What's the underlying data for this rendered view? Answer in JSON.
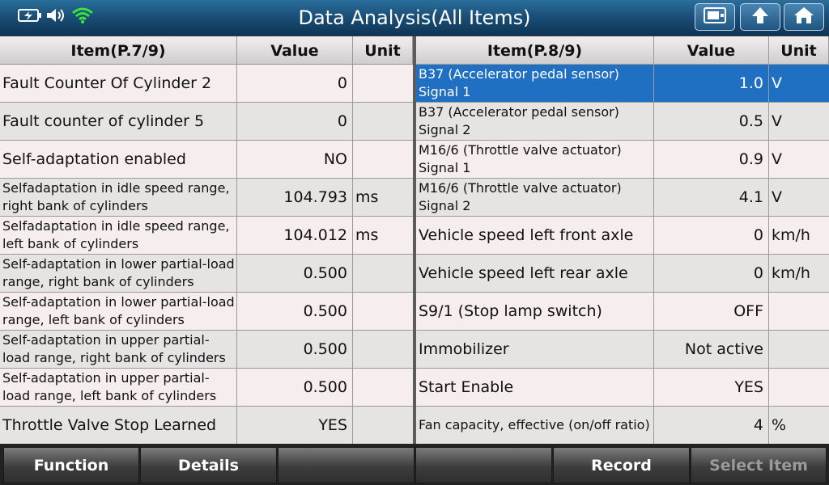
{
  "title": "Data Analysis(All Items)",
  "status_icons": [
    "battery-icon",
    "speaker-icon",
    "wifi-icon"
  ],
  "toolbar_icons": [
    "screenshot-icon",
    "back-icon",
    "home-icon"
  ],
  "colors": {
    "titlebar": "#1b4f78",
    "selected": "#1f6fc3",
    "row_light": "#f6eeee",
    "row_dark": "#e6e3e3",
    "wifi": "#3ce23c"
  },
  "left": {
    "headers": {
      "item": "Item(P.7/9)",
      "value": "Value",
      "unit": "Unit"
    },
    "rows": [
      {
        "item": "Fault Counter Of Cylinder 2",
        "value": "0",
        "unit": ""
      },
      {
        "item": "Fault counter of cylinder 5",
        "value": "0",
        "unit": ""
      },
      {
        "item": "Self-adaptation enabled",
        "value": "NO",
        "unit": ""
      },
      {
        "item": "Selfadaptation in idle speed range, right bank of cylinders",
        "value": "104.793",
        "unit": "ms"
      },
      {
        "item": "Selfadaptation in idle speed range, left bank of cylinders",
        "value": "104.012",
        "unit": "ms"
      },
      {
        "item": "Self-adaptation in lower partial-load range, right bank of cylinders",
        "value": "0.500",
        "unit": ""
      },
      {
        "item": "Self-adaptation in lower partial-load range, left bank of cylinders",
        "value": "0.500",
        "unit": ""
      },
      {
        "item": "Self-adaptation in upper partial-load range, right bank of cylinders",
        "value": "0.500",
        "unit": ""
      },
      {
        "item": "Self-adaptation in upper partial-load range, left bank of cylinders",
        "value": "0.500",
        "unit": ""
      },
      {
        "item": "Throttle Valve Stop Learned",
        "value": "YES",
        "unit": ""
      }
    ]
  },
  "right": {
    "headers": {
      "item": "Item(P.8/9)",
      "value": "Value",
      "unit": "Unit"
    },
    "rows": [
      {
        "item": "B37 (Accelerator pedal sensor) Signal 1",
        "value": "1.0",
        "unit": "V"
      },
      {
        "item": "B37 (Accelerator pedal sensor) Signal 2",
        "value": "0.5",
        "unit": "V"
      },
      {
        "item": "M16/6 (Throttle valve actuator) Signal 1",
        "value": "0.9",
        "unit": "V"
      },
      {
        "item": "M16/6 (Throttle valve actuator) Signal 2",
        "value": "4.1",
        "unit": "V"
      },
      {
        "item": "Vehicle speed left front axle",
        "value": "0",
        "unit": "km/h"
      },
      {
        "item": "Vehicle speed left rear axle",
        "value": "0",
        "unit": "km/h"
      },
      {
        "item": "S9/1 (Stop lamp switch)",
        "value": "OFF",
        "unit": ""
      },
      {
        "item": "Immobilizer",
        "value": "Not active",
        "unit": ""
      },
      {
        "item": "Start Enable",
        "value": "YES",
        "unit": ""
      },
      {
        "item": "Fan capacity, effective (on/off ratio)",
        "value": "4",
        "unit": "%"
      }
    ]
  },
  "buttons": {
    "function": "Function",
    "details": "Details",
    "blank1": "",
    "blank2": "",
    "record": "Record",
    "select_item": "Select Item"
  }
}
